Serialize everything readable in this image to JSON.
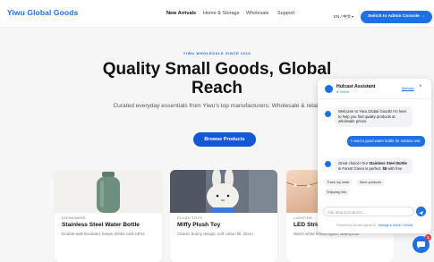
{
  "brand": "Yiwu Global Goods",
  "nav": {
    "items": [
      {
        "label": "New Arrivals"
      },
      {
        "label": "Home & Storage"
      },
      {
        "label": "Wholesale"
      },
      {
        "label": "Support"
      }
    ],
    "language": "EN / 中文",
    "admin_button": "Switch to Admin Console →"
  },
  "hero": {
    "kicker": "YIWU WHOLESALE SINCE 2018",
    "title": "Quality Small Goods, Global Reach",
    "subtitle": "Curated everyday essentials from Yiwu's top manufacturers. Wholesale & retail.",
    "cta": "Browse Products"
  },
  "products": [
    {
      "category": "DRINKWARE",
      "name": "Stainless Steel Water Bottle",
      "desc": "Double-wall insulated, keeps drinks cold 24hrs"
    },
    {
      "category": "PLUSH TOYS",
      "name": "Miffy Plush Toy",
      "desc": "Classic bunny design, soft cotton fill. 25cm"
    },
    {
      "category": "LIGHTING",
      "name": "LED String Lights (10m)",
      "desc": "Warm white festive lights, waterproof"
    }
  ],
  "chat": {
    "title": "Hulcast Assistant",
    "status": "● Online",
    "manage": "Manage",
    "close": "×",
    "bot_greeting": "Welcome to Yiwu Global Goods! I'm here to help you find quality products at wholesale prices.",
    "user_message": "I need a good water bottle for outdoor use",
    "bot_reply_pre": "Great choice! Our ",
    "bot_reply_product": "Stainless Steel Bottle",
    "bot_reply_mid": " in Forest Green is perfect. ",
    "bot_reply_price": "$8",
    "bot_reply_post": " with free",
    "chips": [
      "Track my order",
      "More products",
      "Shipping info"
    ],
    "input_placeholder": "Ask about products...",
    "footer_text": "Powered by Hulcast Agents AI · ",
    "footer_link": "Manage in Admin Console"
  },
  "fab": {
    "badge": "1"
  },
  "colors": {
    "accent": "#1f6fe5",
    "badge": "#e53935",
    "bottle": "#6f8f7e"
  }
}
